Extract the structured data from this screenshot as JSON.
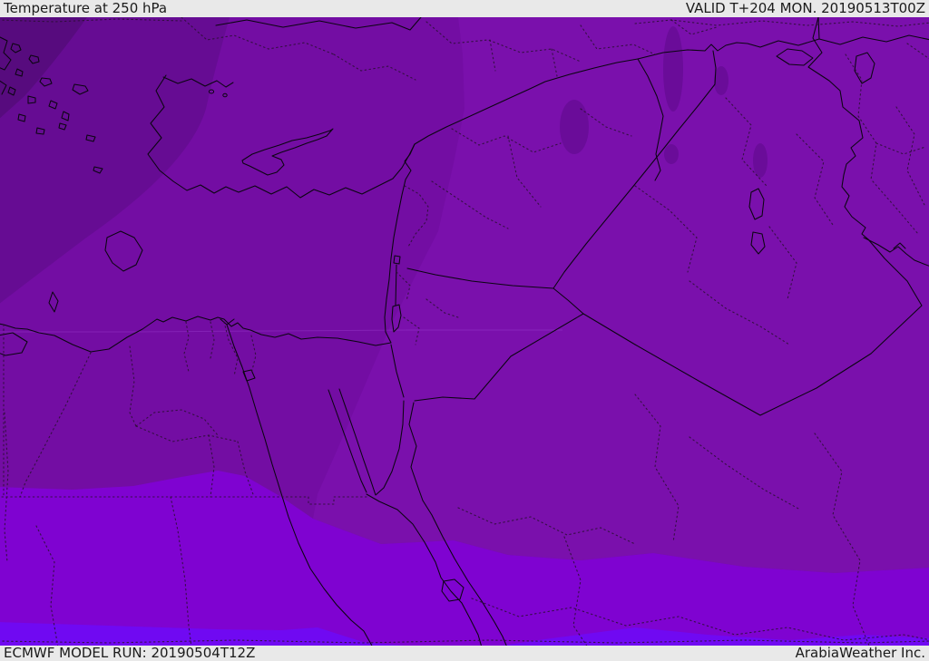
{
  "header": {
    "title": "Temperature at 250 hPa",
    "valid_label": "VALID T+204 MON. 20190513T00Z"
  },
  "footer": {
    "model_run": "ECMWF MODEL RUN: 20190504T12Z",
    "brand": "ArabiaWeather Inc."
  },
  "palette": {
    "bar_bg": "#e9e9e9",
    "bar_text": "#1b1b1b",
    "band_coldest": "#570b7e",
    "band_cold": "#660c93",
    "band_base": "#730da3",
    "band_mild": "#7a10ac",
    "band_warm": "#7f03d1",
    "band_warmest": "#7009f2",
    "cold_patch": "#6a0c99",
    "border_line": "#0a0510",
    "admin_dotted": "#2a0f33",
    "faint_contour": "#a449d8"
  }
}
